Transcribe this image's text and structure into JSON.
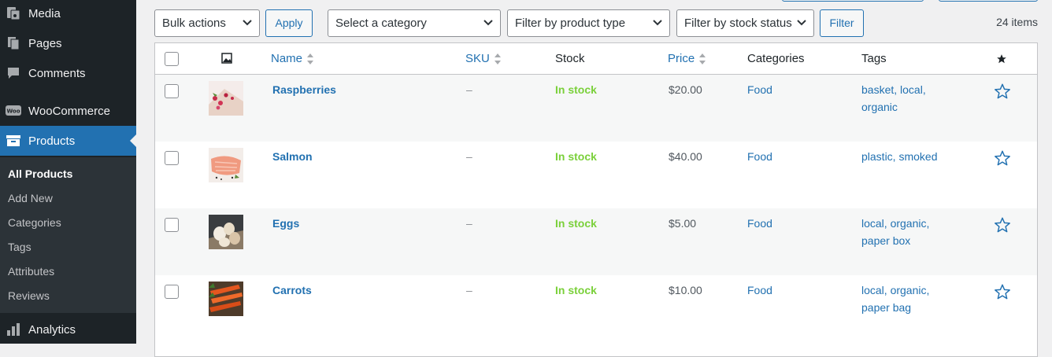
{
  "sidebar": {
    "menu": [
      {
        "label": "Media",
        "icon": "media-icon"
      },
      {
        "label": "Pages",
        "icon": "pages-icon"
      },
      {
        "label": "Comments",
        "icon": "comments-icon"
      },
      {
        "label": "WooCommerce",
        "icon": "woocommerce-icon"
      },
      {
        "label": "Products",
        "icon": "products-icon",
        "active": true
      },
      {
        "label": "Analytics",
        "icon": "analytics-icon"
      }
    ],
    "submenu": [
      {
        "label": "All Products",
        "current": true
      },
      {
        "label": "Add New"
      },
      {
        "label": "Categories"
      },
      {
        "label": "Tags"
      },
      {
        "label": "Attributes"
      },
      {
        "label": "Reviews"
      }
    ]
  },
  "toolbar": {
    "bulk_actions": "Bulk actions",
    "apply": "Apply",
    "category": "Select a category",
    "product_type": "Filter by product type",
    "stock_status": "Filter by stock status",
    "filter": "Filter",
    "items_count": "24 items"
  },
  "table": {
    "headers": {
      "name": "Name",
      "sku": "SKU",
      "stock": "Stock",
      "price": "Price",
      "categories": "Categories",
      "tags": "Tags"
    },
    "rows": [
      {
        "name": "Raspberries",
        "sku": "–",
        "stock": "In stock",
        "price": "$20.00",
        "category": "Food",
        "tags": "basket, local, organic"
      },
      {
        "name": "Salmon",
        "sku": "–",
        "stock": "In stock",
        "price": "$40.00",
        "category": "Food",
        "tags": "plastic, smoked"
      },
      {
        "name": "Eggs",
        "sku": "–",
        "stock": "In stock",
        "price": "$5.00",
        "category": "Food",
        "tags": "local, organic, paper box"
      },
      {
        "name": "Carrots",
        "sku": "–",
        "stock": "In stock",
        "price": "$10.00",
        "category": "Food",
        "tags": "local, organic, paper bag"
      }
    ]
  },
  "colors": {
    "accent": "#2271b1",
    "sidebar": "#1d2327",
    "in_stock": "#7ad03a"
  }
}
